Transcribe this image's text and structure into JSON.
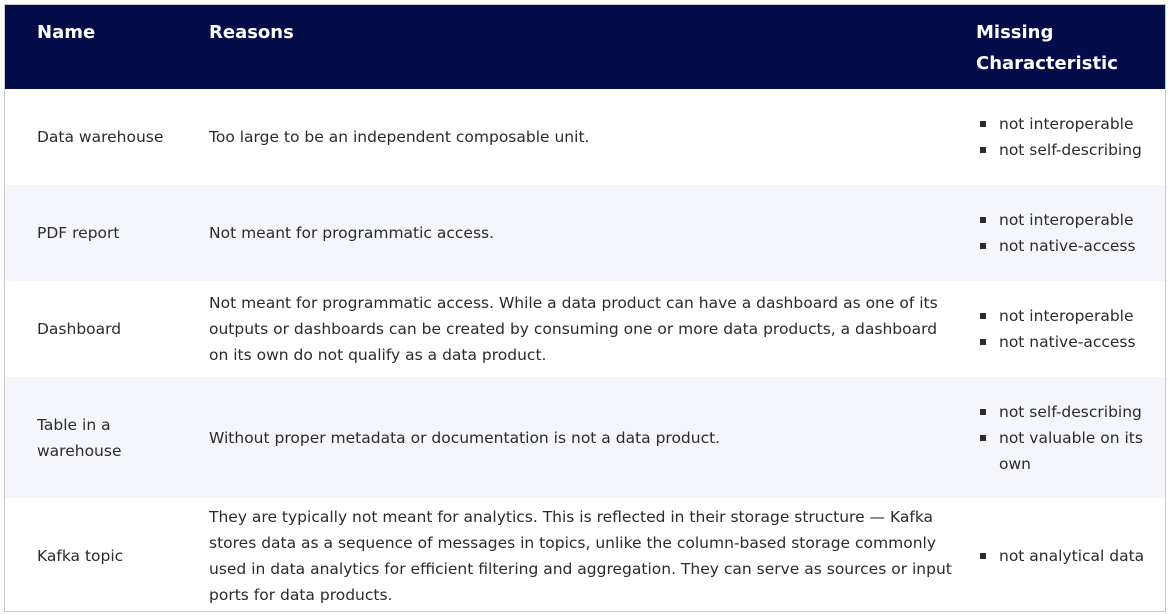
{
  "table": {
    "headers": {
      "name": "Name",
      "reasons": "Reasons",
      "missing": "Missing Characteristic"
    },
    "rows": [
      {
        "name": "Data warehouse",
        "reason": "Too large to be an independent composable unit.",
        "missing": [
          "not interoperable",
          "not self-describing"
        ]
      },
      {
        "name": "PDF report",
        "reason": "Not meant for programmatic access.",
        "missing": [
          "not interoperable",
          "not native-access"
        ]
      },
      {
        "name": "Dashboard",
        "reason": "Not meant for programmatic access. While a data product can have a dashboard as one of its outputs or dashboards can be created by consuming one or more data products, a dashboard on its own do not qualify as a data product.",
        "missing": [
          "not interoperable",
          "not native-access"
        ]
      },
      {
        "name": "Table in a warehouse",
        "reason": "Without proper metadata or documentation is not a data product.",
        "missing": [
          "not self-describing",
          "not valuable on its own"
        ]
      },
      {
        "name": "Kafka topic",
        "reason": "They are typically not meant for analytics. This is reflected in their storage structure — Kafka stores data as a sequence of messages in topics, unlike the column-based storage commonly used in data analytics for efficient filtering and aggregation. They can serve as sources or input ports for data products.",
        "missing": [
          "not analytical data"
        ]
      }
    ]
  }
}
